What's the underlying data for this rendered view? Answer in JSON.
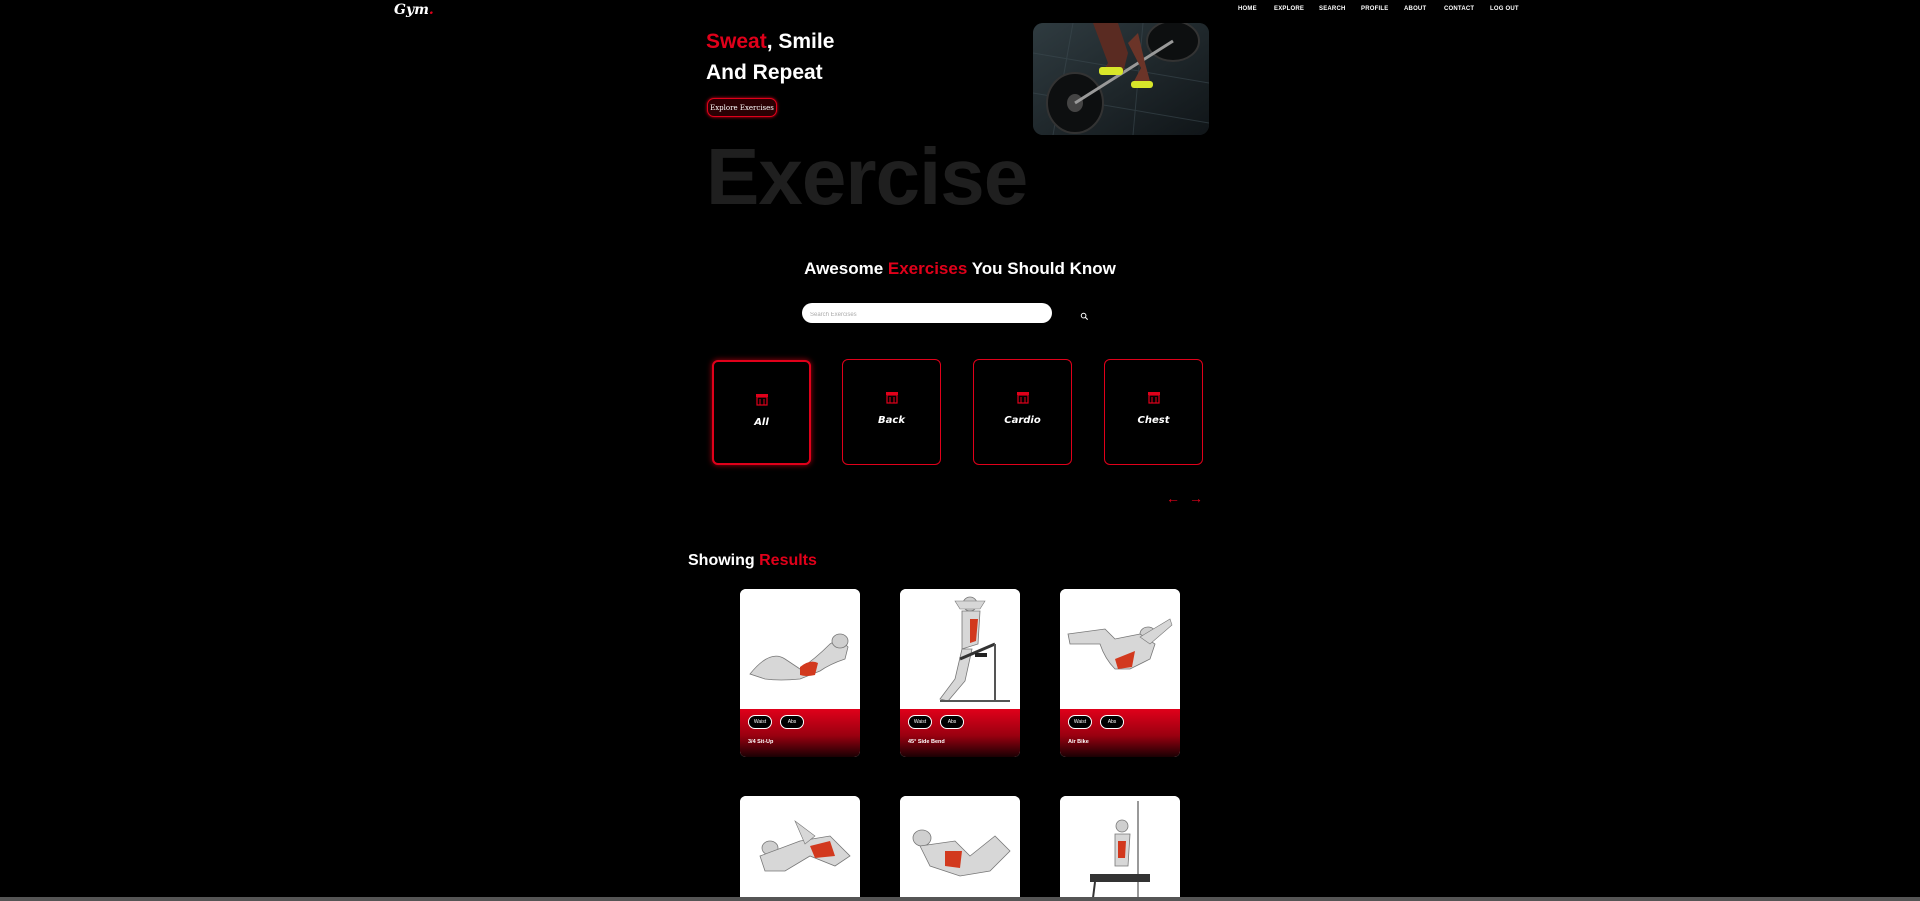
{
  "brand": {
    "logo": "Gym",
    "logo_dot": "."
  },
  "nav": {
    "items": [
      {
        "label": "HOME"
      },
      {
        "label": "EXPLORE"
      },
      {
        "label": "SEARCH"
      },
      {
        "label": "PROFILE"
      },
      {
        "label": "ABOUT"
      },
      {
        "label": "CONTACT"
      },
      {
        "label": "LOG OUT"
      }
    ]
  },
  "hero": {
    "title_red": "Sweat",
    "title_rest_line1": ", Smile",
    "title_line2": "And Repeat",
    "cta_label": "Explore Exercises",
    "image_icon": "barbell-photo",
    "background_word": "Exercise"
  },
  "search_section": {
    "title_pre": "Awesome ",
    "title_red": "Exercises",
    "title_post": " You Should Know",
    "placeholder": "Search Exercises",
    "value": "",
    "search_icon": "search-icon"
  },
  "categories": {
    "items": [
      {
        "label": "All",
        "icon": "gym-icon",
        "selected": true
      },
      {
        "label": "Back",
        "icon": "gym-icon",
        "selected": false
      },
      {
        "label": "Cardio",
        "icon": "gym-icon",
        "selected": false
      },
      {
        "label": "Chest",
        "icon": "gym-icon",
        "selected": false
      }
    ],
    "prev_label": "←",
    "next_label": "→"
  },
  "results": {
    "title_pre": "Showing ",
    "title_red": "Results",
    "cards": [
      {
        "name": "3/4 Sit-Up",
        "tags": [
          "Waist",
          "Abs"
        ]
      },
      {
        "name": "45° Side Bend",
        "tags": [
          "Waist",
          "Abs"
        ]
      },
      {
        "name": "Air Bike",
        "tags": [
          "Waist",
          "Abs"
        ]
      },
      {
        "name": "",
        "tags": []
      },
      {
        "name": "",
        "tags": []
      },
      {
        "name": "",
        "tags": []
      }
    ]
  },
  "colors": {
    "accent": "#e0001a",
    "background": "#000000",
    "ghost_text": "#1f1f1f"
  }
}
